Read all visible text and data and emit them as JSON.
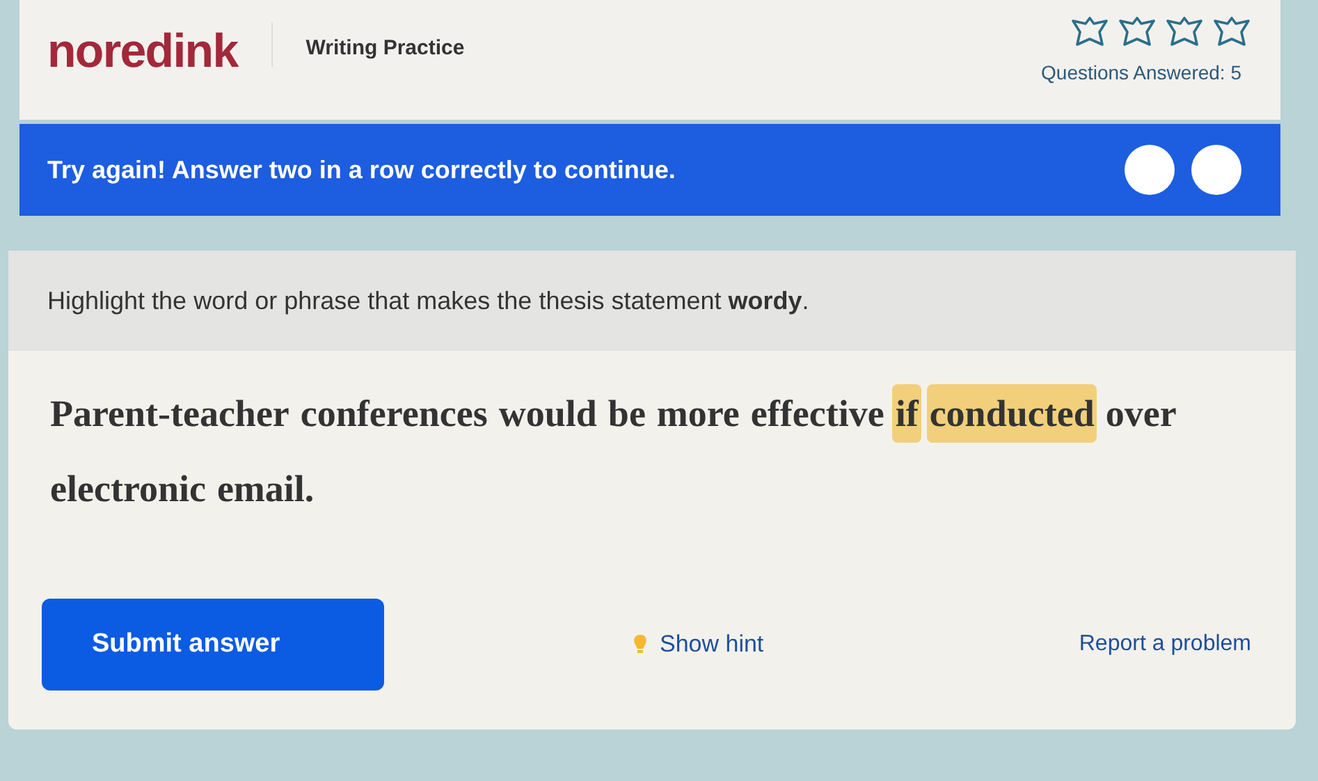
{
  "header": {
    "logo": "noredink",
    "section": "Writing Practice",
    "stars": [
      {
        "filled": false
      },
      {
        "filled": false
      },
      {
        "filled": false
      },
      {
        "filled": false
      }
    ],
    "questions_answered": "Questions Answered: 5"
  },
  "banner": {
    "message": "Try again! Answer two in a row correctly to continue.",
    "streak": [
      {
        "filled": false
      },
      {
        "filled": false
      }
    ]
  },
  "question": {
    "prompt": "Highlight the word or phrase that makes the thesis statement **wordy**.",
    "words": [
      {
        "text": "Parent-teacher",
        "highlighted": false
      },
      {
        "text": "conferences",
        "highlighted": false
      },
      {
        "text": "would",
        "highlighted": false
      },
      {
        "text": "be",
        "highlighted": false
      },
      {
        "text": "more",
        "highlighted": false
      },
      {
        "text": "effective",
        "highlighted": false
      },
      {
        "text": "if",
        "highlighted": true
      },
      {
        "text": "conducted",
        "highlighted": true
      },
      {
        "text": "over",
        "highlighted": false
      },
      {
        "text": "electronic",
        "highlighted": false
      },
      {
        "text": "email.",
        "highlighted": false
      }
    ]
  },
  "actions": {
    "submit": "Submit answer",
    "hint": "Show hint",
    "report": "Report a problem"
  }
}
